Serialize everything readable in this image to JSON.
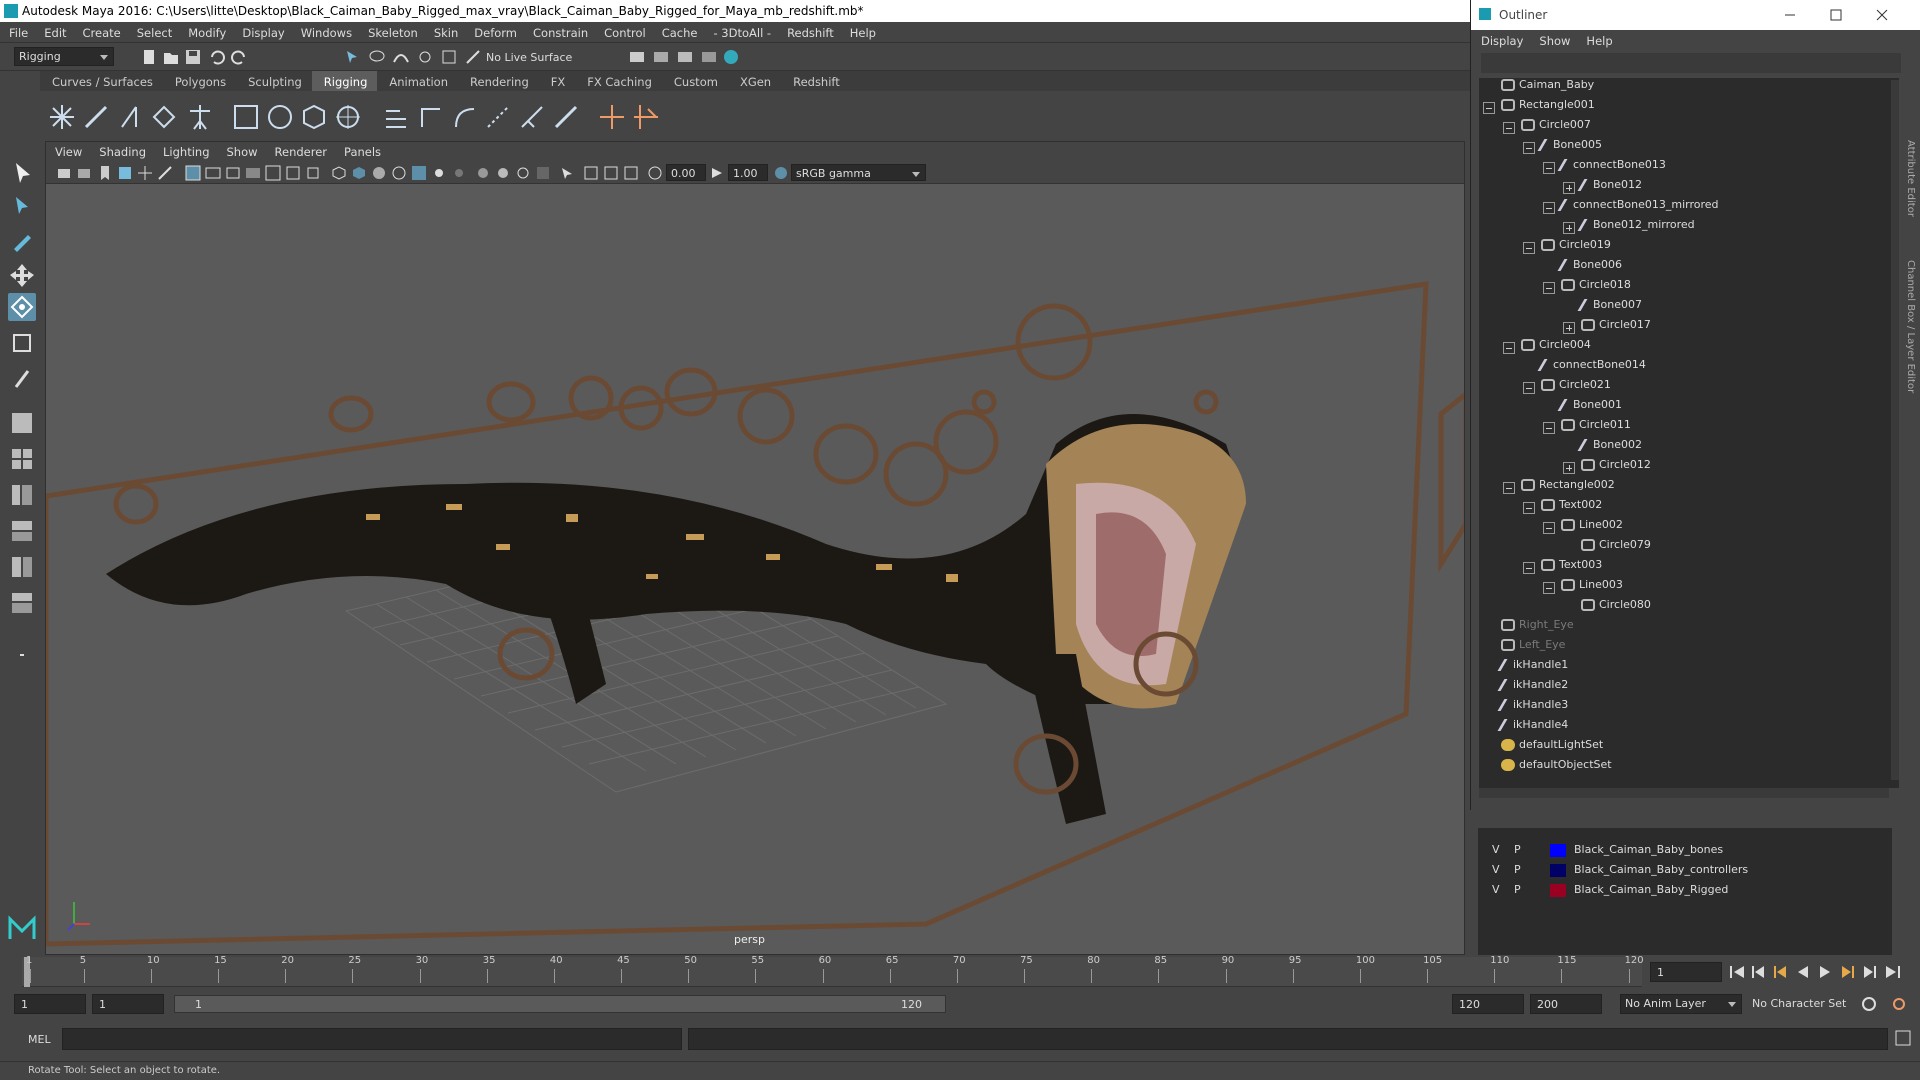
{
  "window": {
    "title": "Autodesk Maya 2016: C:\\Users\\litte\\Desktop\\Black_Caiman_Baby_Rigged_max_vray\\Black_Caiman_Baby_Rigged_for_Maya_mb_redshift.mb*"
  },
  "menubar": [
    "File",
    "Edit",
    "Create",
    "Select",
    "Modify",
    "Display",
    "Windows",
    "Skeleton",
    "Skin",
    "Deform",
    "Constrain",
    "Control",
    "Cache",
    "- 3DtoAll -",
    "Redshift",
    "Help"
  ],
  "statusline": {
    "mode": "Rigging",
    "live_surface": "No Live Surface"
  },
  "shelf": {
    "tabs": [
      "Curves / Surfaces",
      "Polygons",
      "Sculpting",
      "Rigging",
      "Animation",
      "Rendering",
      "FX",
      "FX Caching",
      "Custom",
      "XGen",
      "Redshift"
    ],
    "active": "Rigging"
  },
  "viewport": {
    "menu": [
      "View",
      "Shading",
      "Lighting",
      "Show",
      "Renderer",
      "Panels"
    ],
    "exposure": "0.00",
    "gamma": "1.00",
    "colorspace": "sRGB gamma",
    "camera": "persp"
  },
  "outliner": {
    "title": "Outliner",
    "menu": [
      "Display",
      "Show",
      "Help"
    ],
    "nodes": [
      {
        "label": "Caiman_Baby",
        "level": 0,
        "box": "",
        "icon": "transform",
        "dim": false
      },
      {
        "label": "Rectangle001",
        "level": 0,
        "box": "minus",
        "icon": "transform",
        "dim": false
      },
      {
        "label": "Circle007",
        "level": 1,
        "box": "minus",
        "icon": "transform",
        "dim": false
      },
      {
        "label": "Bone005",
        "level": 2,
        "box": "minus",
        "icon": "joint",
        "dim": false
      },
      {
        "label": "connectBone013",
        "level": 3,
        "box": "minus",
        "icon": "joint",
        "dim": false
      },
      {
        "label": "Bone012",
        "level": 4,
        "box": "plus",
        "icon": "joint",
        "dim": false
      },
      {
        "label": "connectBone013_mirrored",
        "level": 3,
        "box": "minus",
        "icon": "joint",
        "dim": false
      },
      {
        "label": "Bone012_mirrored",
        "level": 4,
        "box": "plus",
        "icon": "joint",
        "dim": false
      },
      {
        "label": "Circle019",
        "level": 2,
        "box": "minus",
        "icon": "transform",
        "dim": false
      },
      {
        "label": "Bone006",
        "level": 3,
        "box": "",
        "icon": "joint",
        "dim": false
      },
      {
        "label": "Circle018",
        "level": 3,
        "box": "minus",
        "icon": "transform",
        "dim": false
      },
      {
        "label": "Bone007",
        "level": 4,
        "box": "",
        "icon": "joint",
        "dim": false
      },
      {
        "label": "Circle017",
        "level": 4,
        "box": "plus",
        "icon": "transform",
        "dim": false
      },
      {
        "label": "Circle004",
        "level": 1,
        "box": "minus",
        "icon": "transform",
        "dim": false
      },
      {
        "label": "connectBone014",
        "level": 2,
        "box": "",
        "icon": "joint",
        "dim": false
      },
      {
        "label": "Circle021",
        "level": 2,
        "box": "minus",
        "icon": "transform",
        "dim": false
      },
      {
        "label": "Bone001",
        "level": 3,
        "box": "",
        "icon": "joint",
        "dim": false
      },
      {
        "label": "Circle011",
        "level": 3,
        "box": "minus",
        "icon": "transform",
        "dim": false
      },
      {
        "label": "Bone002",
        "level": 4,
        "box": "",
        "icon": "joint",
        "dim": false
      },
      {
        "label": "Circle012",
        "level": 4,
        "box": "plus",
        "icon": "transform",
        "dim": false
      },
      {
        "label": "Rectangle002",
        "level": 1,
        "box": "minus",
        "icon": "transform",
        "dim": false
      },
      {
        "label": "Text002",
        "level": 2,
        "box": "minus",
        "icon": "transform",
        "dim": false
      },
      {
        "label": "Line002",
        "level": 3,
        "box": "minus",
        "icon": "transform",
        "dim": false
      },
      {
        "label": "Circle079",
        "level": 4,
        "box": "",
        "icon": "transform",
        "dim": false
      },
      {
        "label": "Text003",
        "level": 2,
        "box": "minus",
        "icon": "transform",
        "dim": false
      },
      {
        "label": "Line003",
        "level": 3,
        "box": "minus",
        "icon": "transform",
        "dim": false
      },
      {
        "label": "Circle080",
        "level": 4,
        "box": "",
        "icon": "transform",
        "dim": false
      },
      {
        "label": "Right_Eye",
        "level": 0,
        "box": "",
        "icon": "transform",
        "dim": true
      },
      {
        "label": "Left_Eye",
        "level": 0,
        "box": "",
        "icon": "transform",
        "dim": true
      },
      {
        "label": "ikHandle1",
        "level": 0,
        "box": "",
        "icon": "ik",
        "dim": false
      },
      {
        "label": "ikHandle2",
        "level": 0,
        "box": "",
        "icon": "ik",
        "dim": false
      },
      {
        "label": "ikHandle3",
        "level": 0,
        "box": "",
        "icon": "ik",
        "dim": false
      },
      {
        "label": "ikHandle4",
        "level": 0,
        "box": "",
        "icon": "ik",
        "dim": false
      },
      {
        "label": "defaultLightSet",
        "level": 0,
        "box": "",
        "icon": "set",
        "dim": false
      },
      {
        "label": "defaultObjectSet",
        "level": 0,
        "box": "",
        "icon": "set",
        "dim": false
      }
    ]
  },
  "layers": [
    {
      "v": "V",
      "p": "P",
      "color": "#0000ff",
      "name": "Black_Caiman_Baby_bones"
    },
    {
      "v": "V",
      "p": "P",
      "color": "#000066",
      "name": "Black_Caiman_Baby_controllers"
    },
    {
      "v": "V",
      "p": "P",
      "color": "#990022",
      "name": "Black_Caiman_Baby_Rigged"
    }
  ],
  "timeline": {
    "ticks": [
      "1",
      "5",
      "10",
      "15",
      "20",
      "25",
      "30",
      "35",
      "40",
      "45",
      "50",
      "55",
      "60",
      "65",
      "70",
      "75",
      "80",
      "85",
      "90",
      "95",
      "100",
      "105",
      "110",
      "115",
      "120"
    ],
    "current_frame": "1"
  },
  "range": {
    "start": "1",
    "start2": "1",
    "slider_start": "1",
    "slider_end": "120",
    "end": "120",
    "end2": "200",
    "anim_layer": "No Anim Layer",
    "char_set": "No Character Set"
  },
  "cmd": {
    "lang": "MEL"
  },
  "help": {
    "text": "Rotate Tool: Select an object to rotate."
  },
  "side_tabs": [
    "Attribute Editor",
    "Channel Box / Layer Editor"
  ]
}
